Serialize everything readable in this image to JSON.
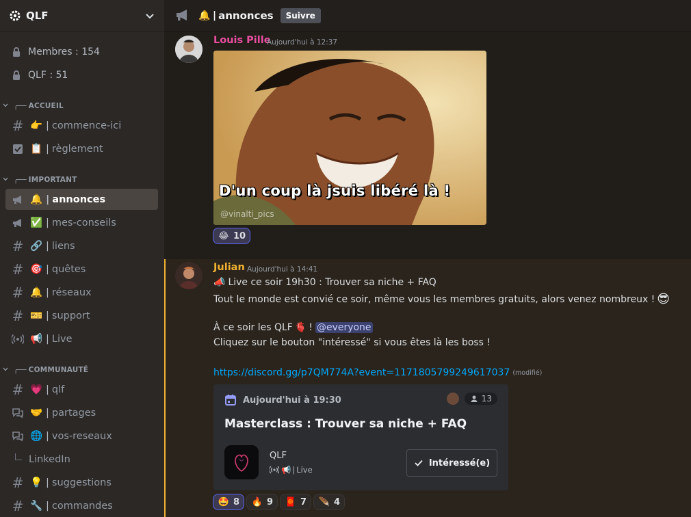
{
  "guild": {
    "name": "QLF"
  },
  "stats": {
    "members": "Membres : 154",
    "qlf": "QLF : 51"
  },
  "categories": {
    "accueil": "ACCUEIL",
    "important": "IMPORTANT",
    "communaute": "COMMUNAUTÉ"
  },
  "channels": {
    "commence": "commence-ici",
    "reglement": "règlement",
    "annonces": "annonces",
    "conseils": "mes-conseils",
    "liens": "liens",
    "quetes": "quêtes",
    "reseaux": "réseaux",
    "support": "support",
    "live": "Live",
    "qlf": "qlf",
    "partages": "partages",
    "vosreseaux": "vos-reseaux",
    "linkedin": "LinkedIn",
    "suggestions": "suggestions",
    "commandes": "commandes"
  },
  "topbar": {
    "channel": "annonces",
    "follow": "Suivre"
  },
  "message1": {
    "author": "Louis Pille",
    "author_color": "#e94fa0",
    "time": "Aujourd'hui à 12:37",
    "gif_caption": "D'un coup là jsuis libéré là !",
    "gif_watermark": "@vinalti_pics",
    "reaction_count": "10"
  },
  "message2": {
    "author": "Julian",
    "author_color": "#f0b232",
    "time": "Aujourd'hui à 14:41",
    "line1": "Live ce soir 19h30 : Trouver sa niche + FAQ",
    "line2": "Tout le monde est convié ce soir, même vous les membres gratuits, alors venez nombreux !",
    "line3": "À ce soir les QLF",
    "line3b": "!",
    "mention": "@everyone",
    "line4": "Cliquez sur le bouton \"intéressé\" si vous êtes là les boss !",
    "link": "https://discord.gg/p7QM774A?event=1171805799249617037",
    "edited": "(modifié)"
  },
  "event": {
    "date": "Aujourd'hui à 19:30",
    "count": "13",
    "title": "Masterclass : Trouver sa niche + FAQ",
    "guild": "QLF",
    "channel": "Live",
    "button": "Intéressé(e)"
  },
  "reactions2": [
    {
      "count": "8"
    },
    {
      "count": "9"
    },
    {
      "count": "7"
    },
    {
      "count": "4"
    }
  ]
}
